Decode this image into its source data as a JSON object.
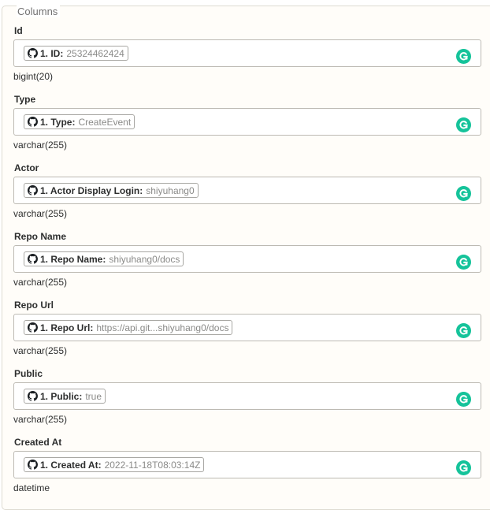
{
  "legend": "Columns",
  "columns": [
    {
      "label": "Id",
      "field_name": "1. ID:",
      "field_value": "25324462424",
      "type": "bigint(20)"
    },
    {
      "label": "Type",
      "field_name": "1. Type:",
      "field_value": "CreateEvent",
      "type": "varchar(255)"
    },
    {
      "label": "Actor",
      "field_name": "1. Actor Display Login:",
      "field_value": "shiyuhang0",
      "type": "varchar(255)"
    },
    {
      "label": "Repo Name",
      "field_name": "1. Repo Name:",
      "field_value": "shiyuhang0/docs",
      "type": "varchar(255)"
    },
    {
      "label": "Repo Url",
      "field_name": "1. Repo Url:",
      "field_value": "https://api.git...shiyuhang0/docs",
      "type": "varchar(255)"
    },
    {
      "label": "Public",
      "field_name": "1. Public:",
      "field_value": "true",
      "type": "varchar(255)"
    },
    {
      "label": "Created At",
      "field_name": "1. Created At:",
      "field_value": "2022-11-18T08:03:14Z",
      "type": "datetime"
    }
  ],
  "colors": {
    "grammarly_green": "#15c39a",
    "border": "#bdbab3",
    "background": "#fffdf9"
  },
  "icons": {
    "pill_icon": "github-icon",
    "field_action_icon": "grammarly-icon"
  }
}
